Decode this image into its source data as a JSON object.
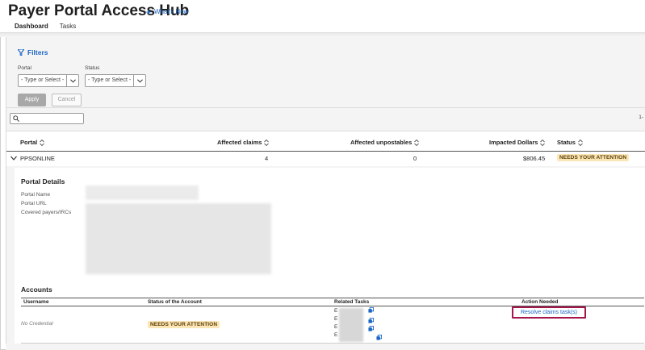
{
  "header": {
    "title": "Payer Portal Access Hub",
    "whats_new": "What's New",
    "tabs": [
      {
        "label": "Dashboard",
        "active": true
      },
      {
        "label": "Tasks",
        "active": false
      }
    ]
  },
  "filters": {
    "title": "Filters",
    "portal_label": "Portal",
    "portal_placeholder": "- Type or Select -",
    "status_label": "Status",
    "status_placeholder": "- Type or Select -",
    "apply_label": "Apply",
    "cancel_label": "Cancel"
  },
  "pager_text": "1-",
  "table": {
    "headers": [
      "Portal",
      "Affected claims",
      "Affected unpostables",
      "Impacted Dollars",
      "Status"
    ],
    "rows": [
      {
        "portal": "PPSONLINE",
        "affected_claims": "4",
        "affected_unpostables": "0",
        "impacted_dollars": "$806.45",
        "status": "NEEDS YOUR ATTENTION"
      }
    ]
  },
  "details": {
    "title": "Portal Details",
    "labels": [
      "Portal Name",
      "Portal URL",
      "Covered payers/IRCs"
    ]
  },
  "accounts": {
    "title": "Accounts",
    "headers": [
      "Username",
      "Status of the Account",
      "Related Tasks",
      "Action Needed"
    ],
    "rows": [
      {
        "username": "No Credential",
        "status": "NEEDS YOUR ATTENTION",
        "tasks": [
          "E",
          "E",
          "E",
          "E"
        ],
        "action": "Resolve claims task(s)"
      }
    ]
  },
  "colors": {
    "link": "#1a64c5",
    "badge_bg": "#fbe6b8",
    "highlight_border": "#a3174d"
  }
}
